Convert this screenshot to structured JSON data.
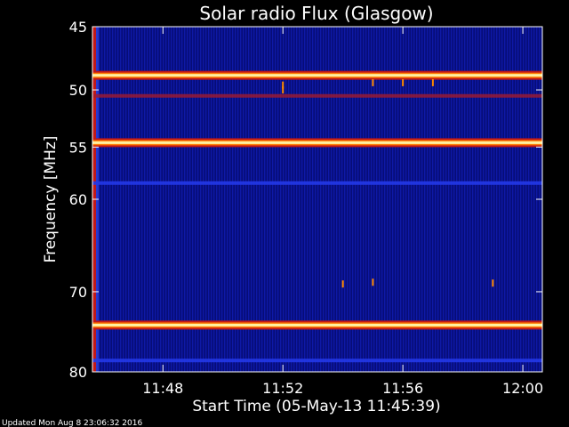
{
  "chart_data": {
    "type": "heatmap",
    "title": "Solar radio Flux (Glasgow)",
    "xlabel": "Start Time (05-May-13 11:45:39)",
    "ylabel": "Frequency [MHz]",
    "x_range": [
      "11:45:39",
      "12:00:39"
    ],
    "x_ticks": [
      {
        "value": "11:48",
        "label": "11:48"
      },
      {
        "value": "11:52",
        "label": "11:52"
      },
      {
        "value": "11:56",
        "label": "11:56"
      },
      {
        "value": "12:00",
        "label": "12:00"
      }
    ],
    "y_range": [
      45,
      80
    ],
    "y_reversed": true,
    "y_scale": "log",
    "y_ticks": [
      45,
      50,
      55,
      60,
      70,
      80
    ],
    "colormap": [
      "#000030",
      "#08108a",
      "#1828d0",
      "#c01818",
      "#ff7a00",
      "#ffe060",
      "#ffffff"
    ],
    "background_color": "#08108a",
    "bright_bands": [
      {
        "freq": 48.8,
        "level": "strong"
      },
      {
        "freq": 54.6,
        "level": "strong"
      },
      {
        "freq": 74.0,
        "level": "strong"
      },
      {
        "freq": 50.5,
        "level": "moderate"
      },
      {
        "freq": 58.4,
        "level": "weak"
      },
      {
        "freq": 78.5,
        "level": "weak"
      }
    ],
    "bursts": [
      {
        "time": "11:52",
        "freq": 49.6
      },
      {
        "time": "11:52",
        "freq": 50.0
      },
      {
        "time": "11:55",
        "freq": 49.4
      },
      {
        "time": "11:56",
        "freq": 49.4
      },
      {
        "time": "11:57",
        "freq": 49.4
      },
      {
        "time": "11:54",
        "freq": 69.1
      },
      {
        "time": "11:55",
        "freq": 68.9
      },
      {
        "time": "11:59",
        "freq": 69.0
      }
    ]
  },
  "footer": {
    "updated": "Updated Mon Aug  8 23:06:32 2016"
  }
}
